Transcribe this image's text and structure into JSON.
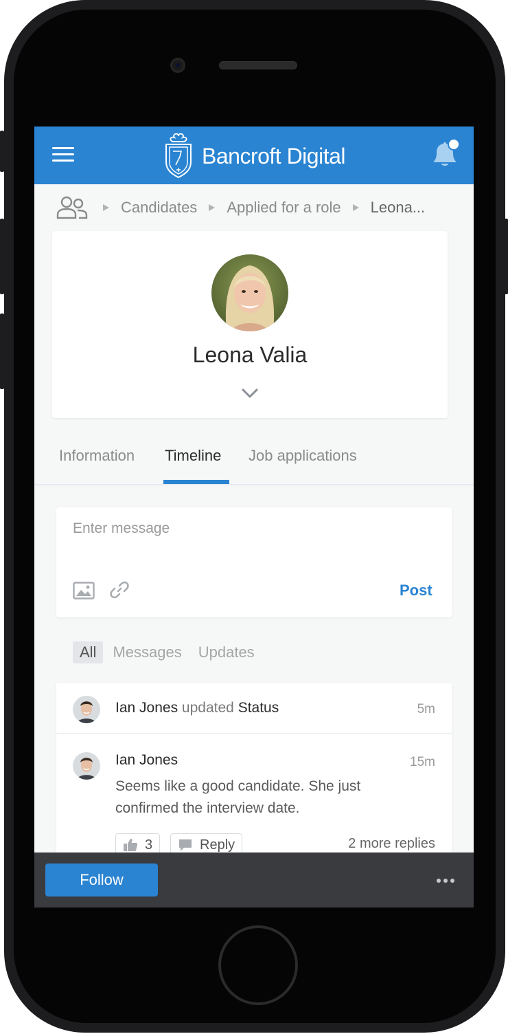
{
  "app": {
    "brand": "Bancroft Digital"
  },
  "colors": {
    "accent": "#2a84d2",
    "bottom_bar": "#3a3b3f",
    "background": "#f6f7f7"
  },
  "header": {
    "menu_icon": "hamburger-icon",
    "bell_icon": "bell-icon",
    "has_notification": true
  },
  "breadcrumb": {
    "icon": "people-icon",
    "items": [
      "Candidates",
      "Applied for a role",
      "Leona..."
    ]
  },
  "profile": {
    "name": "Leona Valia",
    "expand_icon": "chevron-down-icon"
  },
  "tabs": {
    "items": [
      "Information",
      "Timeline",
      "Job applications"
    ],
    "active": "Timeline"
  },
  "composer": {
    "placeholder": "Enter message",
    "post_label": "Post"
  },
  "filters": {
    "items": [
      "All",
      "Messages",
      "Updates"
    ],
    "active": "All"
  },
  "feed": {
    "update": {
      "author": "Ian Jones",
      "action": "updated",
      "field": "Status",
      "time": "5m"
    },
    "comment": {
      "author": "Ian Jones",
      "time": "15m",
      "text": "Seems like a good candidate. She just confirmed the interview date.",
      "likes": "3",
      "reply_label": "Reply",
      "more_replies": "2 more replies"
    }
  },
  "footer": {
    "follow_label": "Follow",
    "more_icon": "more-icon"
  }
}
